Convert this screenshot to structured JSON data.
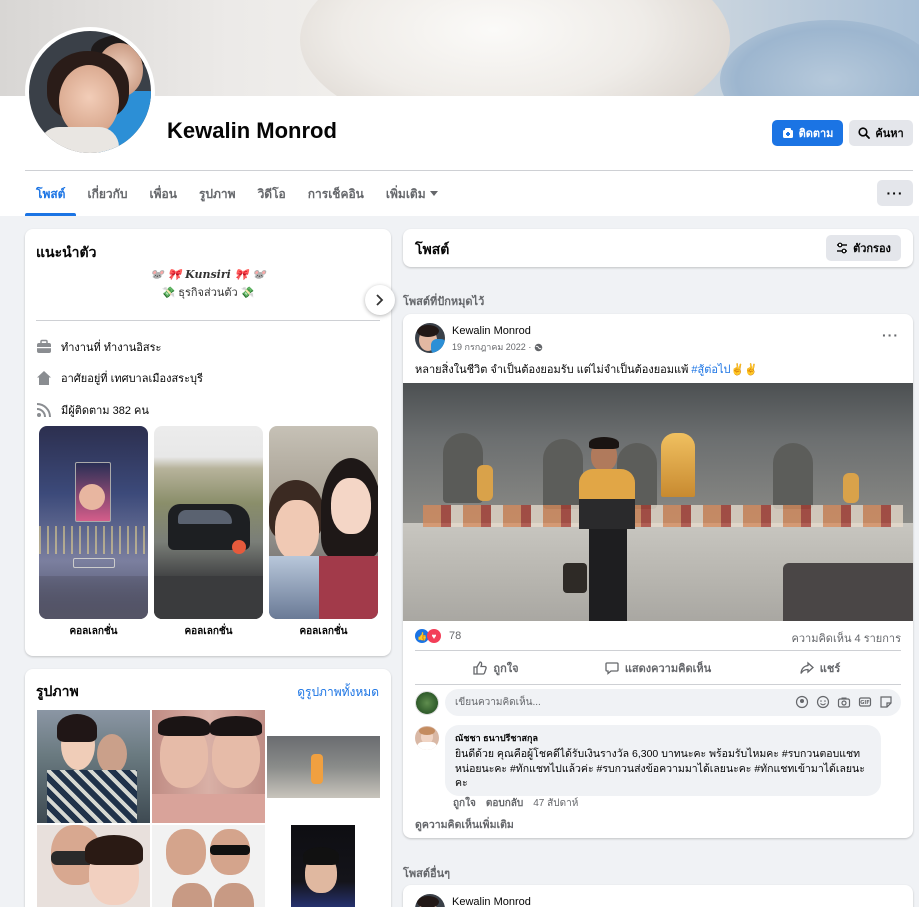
{
  "profile": {
    "name": "Kewalin Monrod",
    "follow_label": "ติดตาม",
    "search_label": "ค้นหา",
    "more_label": "···"
  },
  "tabs": [
    {
      "label": "โพสต์",
      "active": true
    },
    {
      "label": "เกี่ยวกับ",
      "active": false
    },
    {
      "label": "เพื่อน",
      "active": false
    },
    {
      "label": "รูปภาพ",
      "active": false
    },
    {
      "label": "วิดีโอ",
      "active": false
    },
    {
      "label": "การเช็คอิน",
      "active": false
    },
    {
      "label": "เพิ่มเติม",
      "active": false
    }
  ],
  "intro": {
    "title": "แนะนำตัว",
    "bio_line1": "🐭 🎀 Kunsiri 🎀 🐭",
    "bio_line2": "💸 ธุรกิจส่วนตัว 💸",
    "work": "ทำงานที่ ทำงานอิสระ",
    "lives": "อาศัยอยู่ที่ เทศบาลเมืองสระบุรี",
    "followers": "มีผู้ติดตาม 382 คน",
    "highlight_label": "คอลเลกชั่น",
    "highlight_count": 3
  },
  "photos": {
    "title": "รูปภาพ",
    "see_all": "ดูรูปภาพทั้งหมด"
  },
  "posts": {
    "title": "โพสต์",
    "filter_label": "ตัวกรอง",
    "pinned_label": "โพสต์ที่ปักหมุดไว้",
    "other_label": "โพสต์อื่นๆ"
  },
  "post": {
    "author": "Kewalin Monrod",
    "date": "19 กรกฎาคม 2022 ·",
    "text": "หลายสิ่งในชีวิต จำเป็นต้องยอมรับ แต่ไม่จำเป็นต้องยอมแพ้ ",
    "hashtag": "#สู้ต่อไป",
    "emoji": "✌️✌️",
    "reaction_count": "78",
    "comment_count": "ความคิดเห็น 4 รายการ",
    "like_label": "ถูกใจ",
    "comment_label": "แสดงความคิดเห็น",
    "share_label": "แชร์",
    "comment_placeholder": "เขียนความคิดเห็น...",
    "comment": {
      "name": "ณัชชา ธนาปรีชาสกุล",
      "body": "ยินดีด้วย คุณคือผู้โชคดีได้รับเงินรางวัล 6,300 บาทนะคะ พร้อมรับไหมคะ #รบกวนตอบแชทหน่อยนะคะ #ทักแชทไปแล้วค่ะ #รบกวนส่งข้อความมาได้เลยนะคะ #ทักแชทเข้ามาได้เลยนะคะ",
      "like": "ถูกใจ",
      "reply": "ตอบกลับ",
      "time": "47 สัปดาห์"
    },
    "more_comments": "ดูความคิดเห็นเพิ่มเติม"
  },
  "post2": {
    "author": "Kewalin Monrod"
  },
  "colors": {
    "accent": "#1b74e4",
    "background": "#f0f2f5",
    "secondary_text": "#65676b"
  }
}
